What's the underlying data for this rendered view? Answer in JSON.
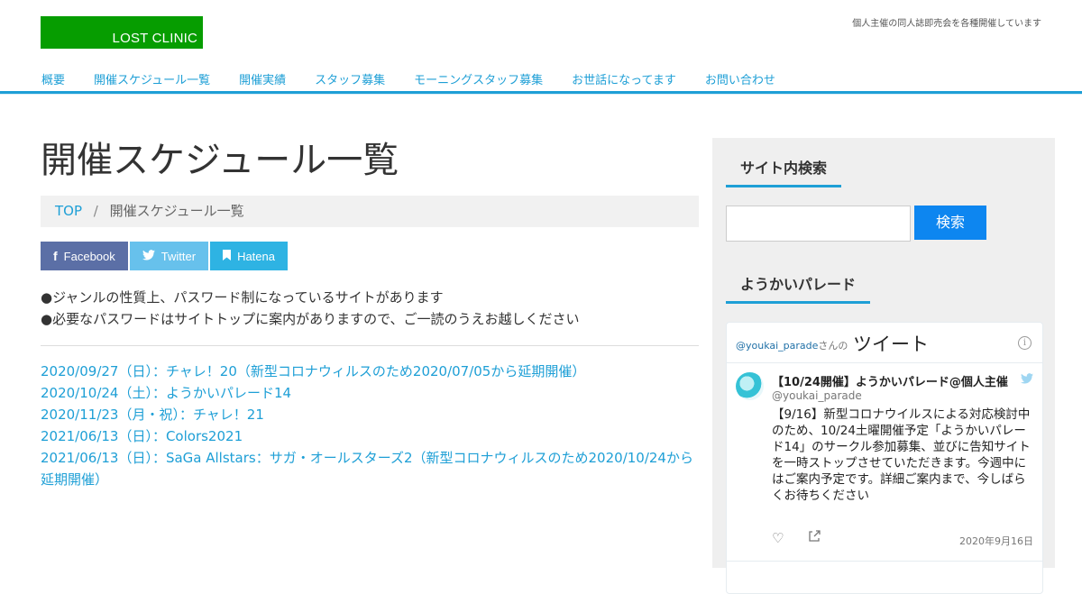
{
  "header": {
    "logo_text": "LOST CLINIC",
    "tagline": "個人主催の同人誌即売会を各種開催しています"
  },
  "nav": [
    {
      "label": "概要",
      "active": false
    },
    {
      "label": "開催スケジュール一覧",
      "active": true
    },
    {
      "label": "開催実績",
      "active": false
    },
    {
      "label": "スタッフ募集",
      "active": false
    },
    {
      "label": "モーニングスタッフ募集",
      "active": false
    },
    {
      "label": "お世話になってます",
      "active": false
    },
    {
      "label": "お問い合わせ",
      "active": false
    }
  ],
  "main": {
    "title": "開催スケジュール一覧",
    "breadcrumb": {
      "top": "TOP",
      "separator": "/",
      "current": "開催スケジュール一覧"
    },
    "share": {
      "facebook": "Facebook",
      "twitter": "Twitter",
      "hatena": "Hatena"
    },
    "notes": [
      "●ジャンルの性質上、パスワード制になっているサイトがあります",
      "●必要なパスワードはサイトトップに案内がありますので、ご一読のうえお越しください"
    ],
    "events": [
      "2020/09/27（日）：チャレ！20（新型コロナウィルスのため2020/07/05から延期開催）",
      "2020/10/24（土）：ようかいパレード14",
      "2020/11/23（月・祝）：チャレ！21",
      "2021/06/13（日）：Colors2021",
      "2021/06/13（日）：SaGa Allstars：サガ・オールスターズ2（新型コロナウィルスのため2020/10/24から延期開催）"
    ]
  },
  "sidebar": {
    "search_title": "サイト内検索",
    "search_button": "検索",
    "search_value": "",
    "widget_title": "ようかいパレード",
    "twitter": {
      "handle": "@youkai_parade",
      "san": "さんの",
      "tweet_label": "ツイート",
      "name": "【10/24開催】ようかいパレード@個人主催",
      "user": "@youkai_parade",
      "text": "【9/16】新型コロナウイルスによる対応検討中のため、10/24土曜開催予定「ようかいパレード14」のサークル参加募集、並びに告知サイトを一時ストップさせていただきます。今週中にはご案内予定です。詳細ご案内まで、今しばらくお待ちください",
      "date": "2020年9月16日"
    }
  },
  "colors": {
    "accent": "#1e9fd6",
    "logo_bg": "#069d00",
    "search_btn": "#0d86f0",
    "facebook": "#5b6fa6",
    "twitter": "#67c1ec",
    "hatena": "#2eb3e3"
  }
}
